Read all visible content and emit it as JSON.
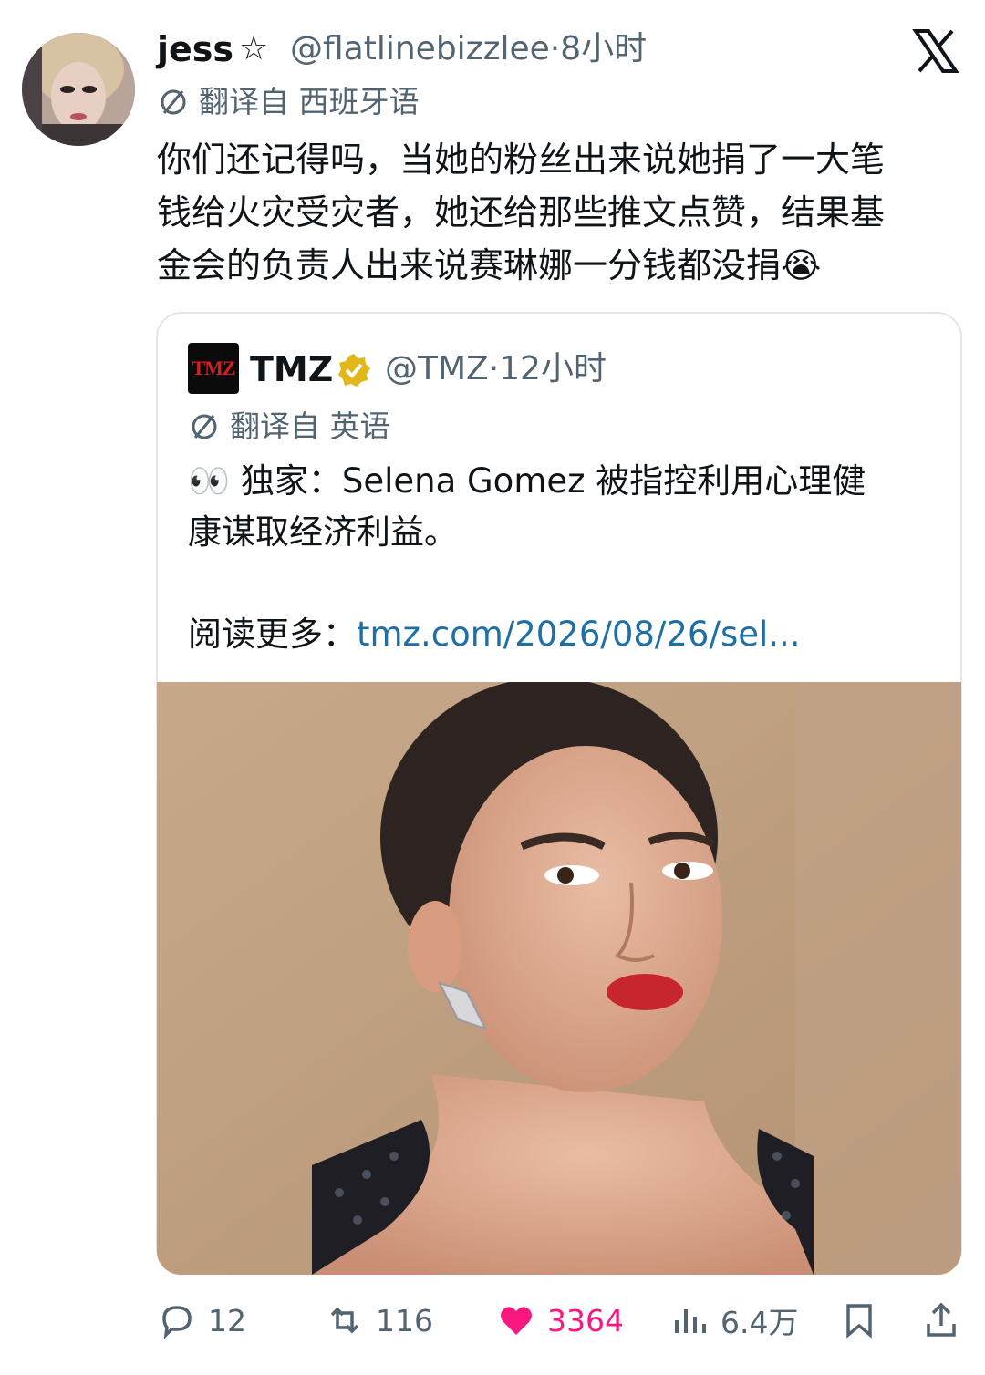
{
  "tweet": {
    "author_name": "jess",
    "author_star": "☆",
    "handle_time": "@flatlinebizzlee·8小时",
    "translated_from": "翻译自 西班牙语",
    "text_lines": [
      "你们还记得吗，当她的粉丝出来说她捐了一大笔",
      "钱给火灾受灾者，她还给那些推文点赞，结果基",
      "金会的负责人出来说赛琳娜一分钱都没捐😭"
    ]
  },
  "quote": {
    "logo_text": "TMZ",
    "author_name": "TMZ",
    "handle_time": "@TMZ·12小时",
    "translated_from": "翻译自 英语",
    "text_lines": [
      "👀 独家：Selena Gomez 被指控利用心理健",
      "康谋取经济利益。"
    ],
    "read_more_label": "阅读更多：",
    "read_more_link": "tmz.com/2026/08/26/sel..."
  },
  "actions": {
    "replies": "12",
    "retweets": "116",
    "likes": "3364",
    "views": "6.4万"
  },
  "colors": {
    "like": "#f91880",
    "link": "#1d6fa5",
    "muted": "#536471",
    "verified": "#e2b719"
  },
  "icons": [
    "x-logo-icon",
    "translate-icon",
    "verified-icon",
    "reply-icon",
    "retweet-icon",
    "heart-icon",
    "views-icon",
    "bookmark-icon",
    "share-icon"
  ]
}
